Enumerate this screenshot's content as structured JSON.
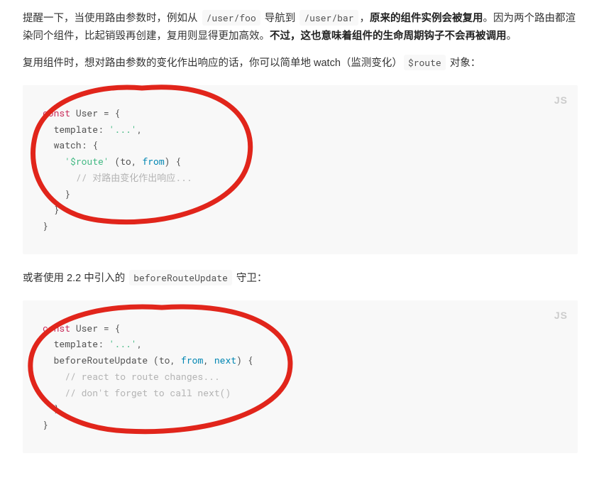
{
  "paragraphs": {
    "p1": {
      "t1": "提醒一下，当使用路由参数时，例如从 ",
      "code1": "/user/foo",
      "t2": " 导航到 ",
      "code2": "/user/bar",
      "t3": "，",
      "bold1": "原来的组件实例会被复用",
      "t4": "。因为两个路由都渲染同个组件，比起销毁再创建，复用则显得更加高效。",
      "bold2": "不过，这也意味着组件的生命周期钩子不会再被调用",
      "t5": "。"
    },
    "p2": {
      "t1": "复用组件时，想对路由参数的变化作出响应的话，你可以简单地 watch（监测变化）",
      "code1": "$route",
      "t2": " 对象："
    },
    "p3": {
      "t1": "或者使用 2.2 中引入的 ",
      "code1": "beforeRouteUpdate",
      "t2": " 守卫："
    }
  },
  "code_blocks": {
    "block1": {
      "lang": "JS",
      "l1_kw": "const",
      "l1_rest": " User = {",
      "l2_pre": "  template: ",
      "l2_str": "'...'",
      "l2_post": ",",
      "l3": "  watch: {",
      "l4_pre": "    ",
      "l4_str": "'$route'",
      "l4_mid": " (to, ",
      "l4_from": "from",
      "l4_post": ") {",
      "l5_cmt": "      // 对路由变化作出响应...",
      "l6": "    }",
      "l7": "  }",
      "l8": "}"
    },
    "block2": {
      "lang": "JS",
      "l1_kw": "const",
      "l1_rest": " User = {",
      "l2_pre": "  template: ",
      "l2_str": "'...'",
      "l2_post": ",",
      "l3_pre": "  beforeRouteUpdate (to, ",
      "l3_from": "from",
      "l3_mid": ", ",
      "l3_next": "next",
      "l3_post": ") {",
      "l4_cmt": "    // react to route changes...",
      "l5_cmt": "    // don't forget to call next()",
      "l6": "  }",
      "l7": "}"
    }
  }
}
